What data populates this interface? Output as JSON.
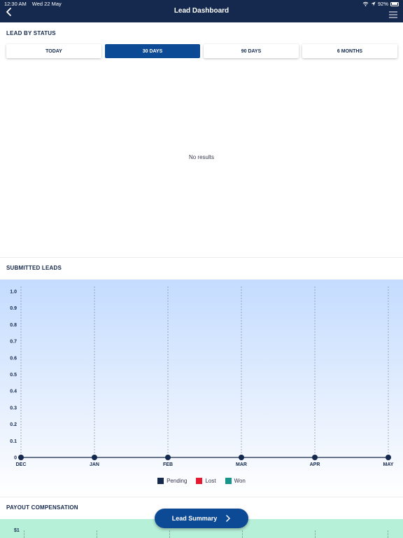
{
  "status_bar": {
    "time": "12:30 AM",
    "date": "Wed 22 May",
    "battery": "92%",
    "battery_level": 0.92
  },
  "nav": {
    "title": "Lead Dashboard",
    "back_icon": "chevron-left-icon",
    "menu_icon": "hamburger-menu-icon"
  },
  "lead_by_status": {
    "title": "LEAD BY STATUS",
    "tabs": [
      {
        "label": "TODAY",
        "active": false
      },
      {
        "label": "30 DAYS",
        "active": true
      },
      {
        "label": "90 DAYS",
        "active": false
      },
      {
        "label": "6 MONTHS",
        "active": false
      }
    ],
    "empty_text": "No results"
  },
  "submitted_leads": {
    "title": "SUBMITTED LEADS",
    "legend": [
      {
        "label": "Pending",
        "color": "#14294d"
      },
      {
        "label": "Lost",
        "color": "#e5192f"
      },
      {
        "label": "Won",
        "color": "#17958a"
      }
    ]
  },
  "chart_data": {
    "type": "line",
    "categories": [
      "DEC",
      "JAN",
      "FEB",
      "MAR",
      "APR",
      "MAY"
    ],
    "yticks": [
      "0",
      "0.1",
      "0.2",
      "0.3",
      "0.4",
      "0.5",
      "0.6",
      "0.7",
      "0.8",
      "0.9",
      "1.0"
    ],
    "ylim": [
      0,
      1
    ],
    "series": [
      {
        "name": "Pending",
        "values": [
          0,
          0,
          0,
          0,
          0,
          0
        ]
      }
    ],
    "grid": "vertical dashed",
    "legend_position": "bottom"
  },
  "payout": {
    "title": "PAYOUT COMPENSATION",
    "first_tick": "$1"
  },
  "summary_button": {
    "label": "Lead Summary",
    "icon": "chevron-right-icon"
  }
}
